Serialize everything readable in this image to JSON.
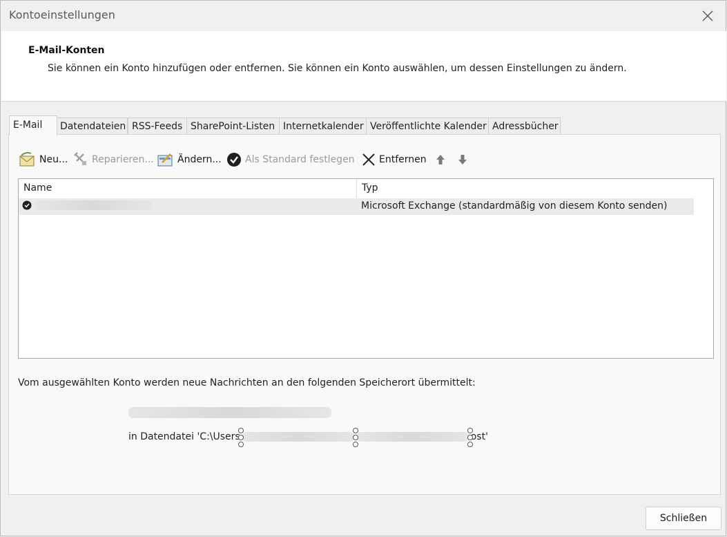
{
  "window": {
    "title": "Kontoeinstellungen"
  },
  "header": {
    "title": "E-Mail-Konten",
    "description": "Sie können ein Konto hinzufügen oder entfernen. Sie können ein Konto auswählen, um dessen Einstellungen zu ändern."
  },
  "tabs": [
    {
      "label": "E-Mail"
    },
    {
      "label": "Datendateien"
    },
    {
      "label": "RSS-Feeds"
    },
    {
      "label": "SharePoint-Listen"
    },
    {
      "label": "Internetkalender"
    },
    {
      "label": "Veröffentlichte Kalender"
    },
    {
      "label": "Adressbücher"
    }
  ],
  "toolbar": {
    "new_label": "Neu...",
    "repair_label": "Reparieren...",
    "change_label": "Ändern...",
    "set_default_label": "Als Standard festlegen",
    "remove_label": "Entfernen",
    "move_up_icon": "arrow-up-icon",
    "move_down_icon": "arrow-down-icon"
  },
  "accounts_table": {
    "columns": [
      "Name",
      "Typ"
    ],
    "rows": [
      {
        "name": "",
        "type": "Microsoft Exchange (standardmäßig von diesem Konto senden)",
        "default": true
      }
    ]
  },
  "delivery": {
    "info_text": "Vom ausgewählten Konto werden neue Nachrichten an den folgenden Speicherort übermittelt:",
    "path_prefix": "in Datendatei 'C:\\Users",
    "path_suffix": "ost'"
  },
  "footer": {
    "close_label": "Schließen"
  },
  "colors": {
    "window_bg": "#f0f0f0",
    "panel_bg": "#f9f9f9",
    "selected_row": "#eaeaea"
  }
}
